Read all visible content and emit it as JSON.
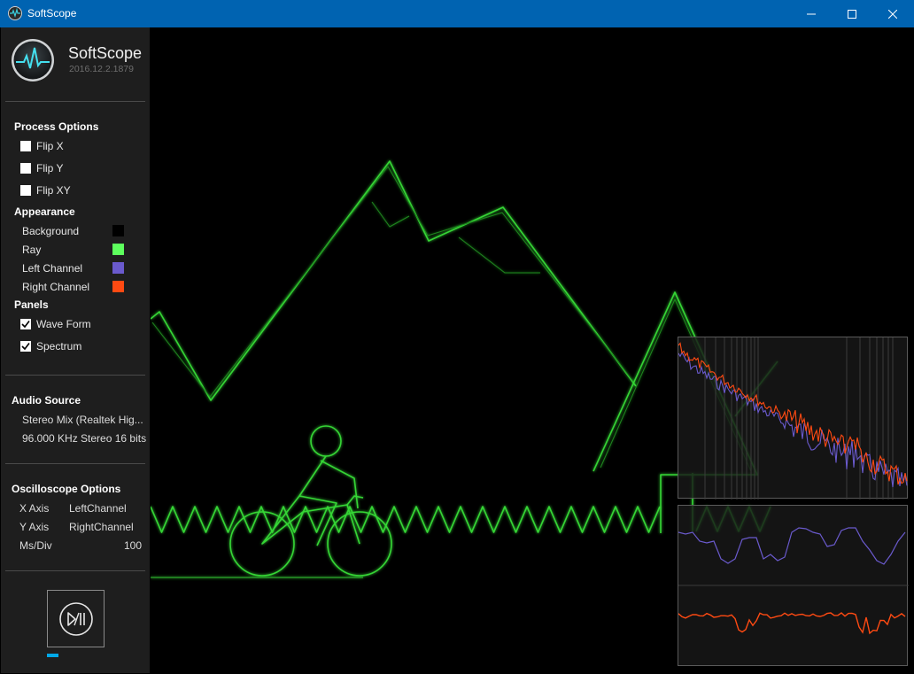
{
  "window": {
    "title": "SoftScope",
    "minimize_icon": "minimize-icon",
    "maximize_icon": "maximize-icon",
    "close_icon": "close-icon"
  },
  "sidebar": {
    "app_name": "SoftScope",
    "version": "2016.12.2.1879",
    "process_options": {
      "heading": "Process Options",
      "items": [
        {
          "label": "Flip X",
          "checked": false
        },
        {
          "label": "Flip Y",
          "checked": false
        },
        {
          "label": "Flip XY",
          "checked": false
        }
      ]
    },
    "appearance": {
      "heading": "Appearance",
      "items": [
        {
          "label": "Background",
          "color": "#000000"
        },
        {
          "label": "Ray",
          "color": "#5dff5d"
        },
        {
          "label": "Left Channel",
          "color": "#6a5acd"
        },
        {
          "label": "Right Channel",
          "color": "#ff4a12"
        }
      ]
    },
    "panels": {
      "heading": "Panels",
      "items": [
        {
          "label": "Wave Form",
          "checked": true
        },
        {
          "label": "Spectrum",
          "checked": true
        }
      ]
    },
    "audio_source": {
      "heading": "Audio Source",
      "device": "Stereo Mix (Realtek Hig...",
      "format": "96.000 KHz Stereo 16 bits"
    },
    "oscilloscope_options": {
      "heading": "Oscilloscope Options",
      "x_axis_label": "X Axis",
      "x_axis_value": "LeftChannel",
      "y_axis_label": "Y Axis",
      "y_axis_value": "RightChannel",
      "msdiv_label": "Ms/Div",
      "msdiv_value": "100"
    },
    "play_pause_icon": "play-pause-icon",
    "playback_progress": 0.11
  },
  "colors": {
    "accent": "#0063b1",
    "ray": "#3cdc3c",
    "left_channel": "#6a5acd",
    "right_channel": "#ff4a12",
    "progress": "#00a8e8"
  }
}
